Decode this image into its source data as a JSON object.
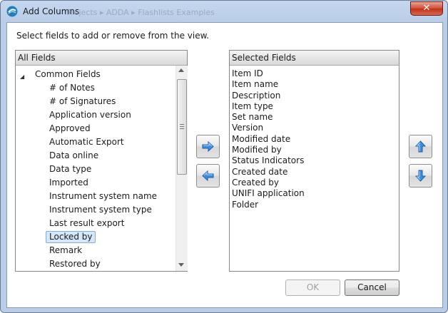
{
  "window": {
    "title": "Add Columns",
    "ghost_breadcrumb": "Projects  ▸  ADDA  ▸  Flashlists Examples",
    "close_glyph": "✕"
  },
  "instruction": "Select fields to add or remove from the view.",
  "all_fields": {
    "header": "All Fields",
    "group_toggle_glyph": "◢",
    "group_label": "Common Fields",
    "items": [
      "# of Notes",
      "# of Signatures",
      "Application version",
      "Approved",
      "Automatic Export",
      "Data online",
      "Data type",
      "Imported",
      "Instrument system name",
      "Instrument system type",
      "Last result export",
      "Locked by",
      "Remark",
      "Restored by"
    ],
    "selected_item": "Locked by"
  },
  "selected_fields": {
    "header": "Selected Fields",
    "items": [
      "Item ID",
      "Item name",
      "Description",
      "Item type",
      "Set name",
      "Version",
      "Modified date",
      "Modified by",
      "Status Indicators",
      "Created date",
      "Created by",
      "UNIFI application",
      "Folder"
    ]
  },
  "buttons": {
    "ok": "OK",
    "cancel": "Cancel"
  },
  "colors": {
    "frame": "#b9cde8",
    "close": "#c9462e",
    "arrow_blue": "#2f7fd6",
    "selection": "#d5e8fa"
  }
}
